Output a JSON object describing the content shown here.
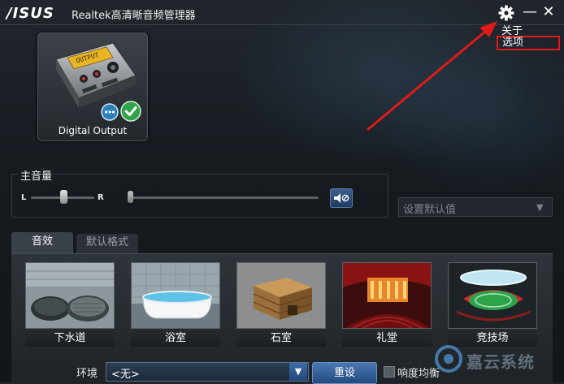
{
  "title_bar": {
    "brand": "/ISUS",
    "app_title": "Realtek高清晰音频管理器",
    "gear_icon": "gear-icon",
    "minimize_glyph": "—",
    "close_glyph": "✕"
  },
  "settings_menu": {
    "items": [
      {
        "label": "关于"
      },
      {
        "label": "选项",
        "highlighted": true
      }
    ]
  },
  "device": {
    "label": "Digital Output",
    "screen_text": "OUTPUT",
    "status_icons": [
      "chat-bubble-icon",
      "checkmark-icon"
    ]
  },
  "master_volume": {
    "title": "主音量",
    "left_label": "L",
    "right_label": "R",
    "balance": 0.5,
    "level": 0.0,
    "mute_icon": "speaker-mute-icon"
  },
  "default_device_select": {
    "placeholder": "设置默认值"
  },
  "tabs": [
    {
      "label": "音效",
      "active": true
    },
    {
      "label": "默认格式",
      "active": false
    }
  ],
  "environments": [
    {
      "label": "下水道"
    },
    {
      "label": "浴室"
    },
    {
      "label": "石室"
    },
    {
      "label": "礼堂"
    },
    {
      "label": "竞技场"
    }
  ],
  "environment_row": {
    "label": "环境",
    "selected": "<无>",
    "reset_label": "重设",
    "loudness_label": "响度均衡",
    "loudness_checked": false
  },
  "watermark": {
    "text": "嘉云系统"
  },
  "colors": {
    "accent_blue": "#3c6aa8",
    "annotation_red": "#e01a1a"
  }
}
